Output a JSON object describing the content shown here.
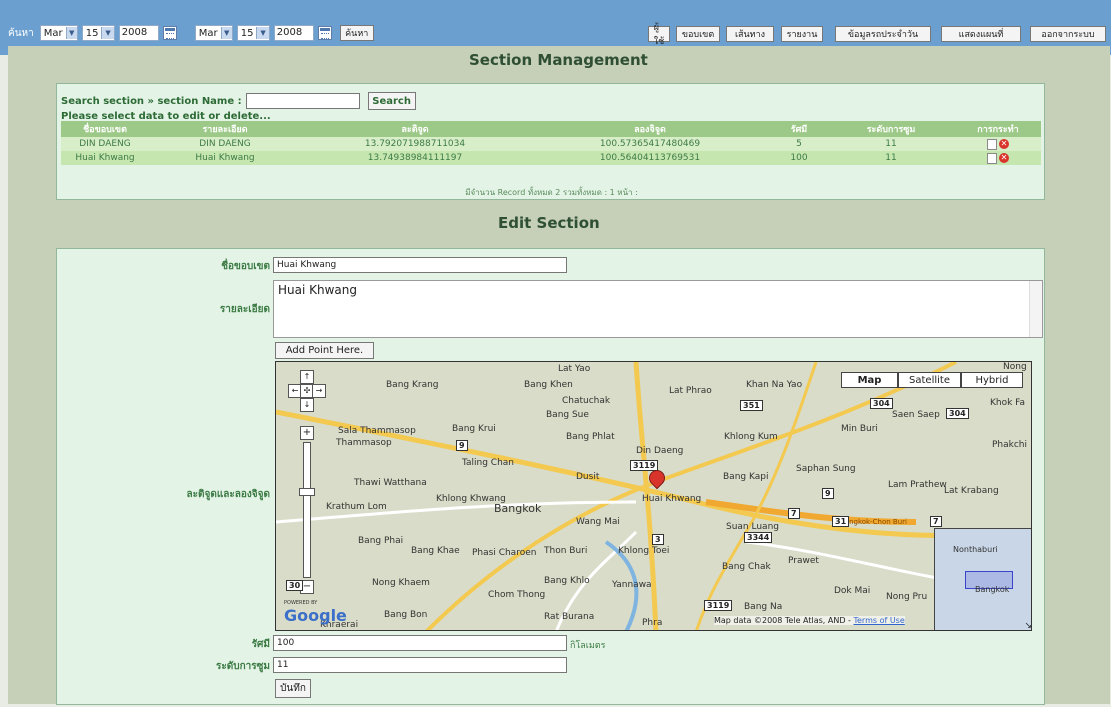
{
  "topbar": {
    "search_label": "ค้นหา",
    "from_month": "Mar",
    "from_day": "15",
    "from_year": "2008",
    "to_month": "Mar",
    "to_day": "15",
    "to_year": "2008",
    "search_button": "ค้นหา",
    "nav": [
      "ผู้ใช้",
      "ขอบเขต",
      "เส้นทาง",
      "รายงาน",
      "ข้อมูลรถประจำวัน",
      "แสดงแผนที่",
      "ออกจากระบบ"
    ]
  },
  "section_management": {
    "title": "Section Management",
    "search_label": "Search section » section Name :",
    "search_value": "",
    "search_button": "Search",
    "select_hint": "Please select data to edit or delete...",
    "columns": [
      "ชื่อขอบเขต",
      "รายละเอียด",
      "ละติจูด",
      "ลองจิจูด",
      "รัศมี",
      "ระดับการซูม",
      "การกระทำ"
    ],
    "rows": [
      [
        "DIN DAENG",
        "DIN DAENG",
        "13.792071988711034",
        "100.57365417480469",
        "5",
        "11"
      ],
      [
        "Huai Khwang",
        "Huai Khwang",
        "13.74938984111197",
        "100.56404113769531",
        "100",
        "11"
      ]
    ],
    "record_count": "มีจำนวน Record ทั้งหมด 2 รวมทั้งหมด : 1 หน้า :"
  },
  "edit_section": {
    "title": "Edit Section",
    "name_label": "ชื่อขอบเขต",
    "name_value": "Huai Khwang",
    "detail_label": "รายละเอียด",
    "detail_value": "Huai Khwang",
    "add_point_button": "Add Point Here.",
    "latlng_label": "ละติจูดและลองจิจูด",
    "radius_label": "รัศมี",
    "radius_value": "100",
    "radius_unit": "กิโลเมตร",
    "zoom_label": "ระดับการซูม",
    "zoom_value": "11",
    "save_button": "บันทึก"
  },
  "map": {
    "type_buttons": [
      "Map",
      "Satellite",
      "Hybrid"
    ],
    "selected_type": "Map",
    "copyright": "Map data ©2008 Tele Atlas, AND -",
    "terms": "Terms of Use",
    "brand": "Google",
    "powered_by": "POWERED BY",
    "marker_label": "Huai Khwang",
    "places": [
      "Bang Krang",
      "Bang Khen",
      "Lat Yao",
      "Lat Phrao",
      "Khan Na Yao",
      "Chatuchak",
      "Bang Sue",
      "Sala Thammasop",
      "Bang Krui",
      "Bang Phlat",
      "Din Daeng",
      "Khlong Kum",
      "Min Buri",
      "Taling Chan",
      "Dusit",
      "Bang Kapi",
      "Saphan Sung",
      "Lam Prathew",
      "Lat Krabang",
      "Thawi Watthana",
      "Khlong Khwang",
      "Bangkok",
      "Krathum Lom",
      "Wang Mai",
      "Huai Khwang",
      "Suan Luang",
      "Bang Phai",
      "Bang Khae",
      "Phasi Charoen",
      "Thon Buri",
      "Khlong Toei",
      "Prawet",
      "Bang Chak",
      "Nong Khaem",
      "Bang Khlo",
      "Yannawa",
      "Bang Na",
      "Bang Bon",
      "Chom Thong",
      "Rat Burana",
      "Phra",
      "Dok Mai",
      "Nong Pru",
      "Saen Saep",
      "Khok Fa",
      "Phakchi",
      "Nong",
      "Khraerai",
      "Thammasop",
      "Nonthaburi",
      "Bangkok-Chon Buri"
    ],
    "road_shields": [
      "351",
      "304",
      "304",
      "9",
      "3119",
      "9",
      "7",
      "31",
      "3344",
      "3",
      "3119",
      "7",
      "30"
    ],
    "overview_labels": [
      "Nonthaburi",
      "Bangkok"
    ]
  },
  "colors": {
    "topbar": "#6a9fd0",
    "frame": "#c6cfb8",
    "panel": "#e3f4e6",
    "table_header": "#9cc987",
    "label_green": "#3d7b45"
  }
}
